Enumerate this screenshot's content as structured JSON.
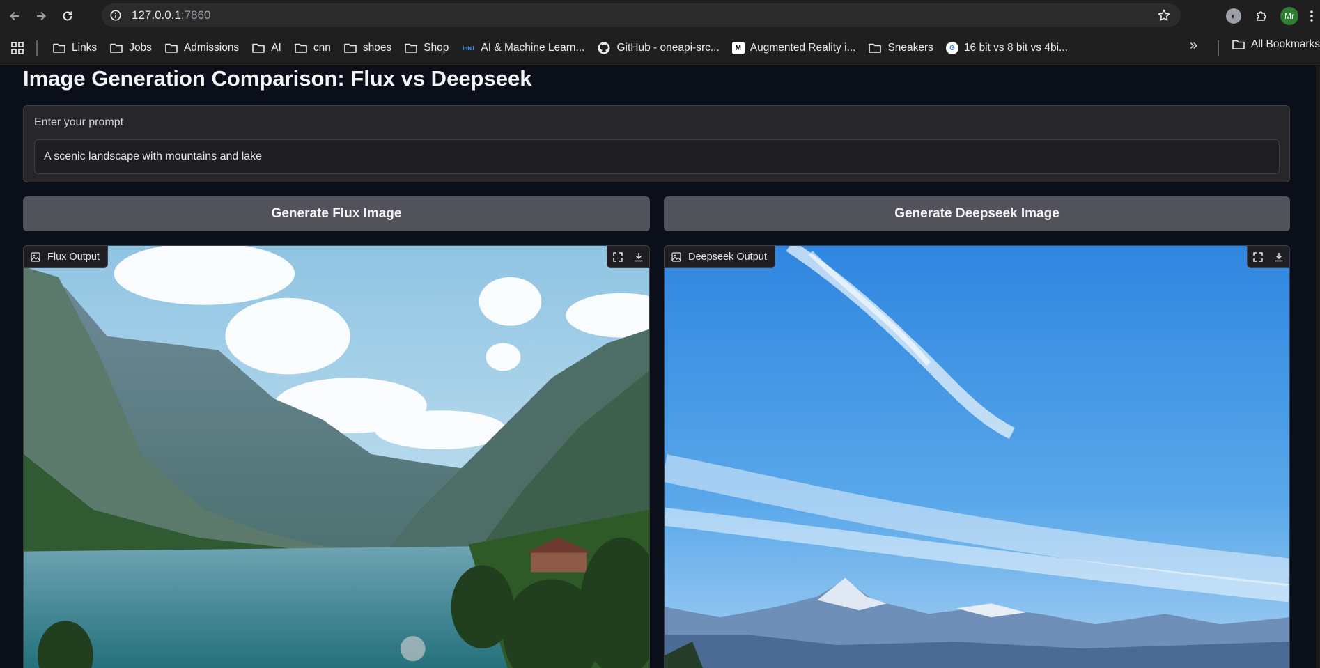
{
  "browser": {
    "url_host": "127.0.0.1",
    "url_port": ":7860",
    "profile_initials": "Mr"
  },
  "bookmarks": [
    {
      "label": "Links",
      "icon": "folder-icon"
    },
    {
      "label": "Jobs",
      "icon": "folder-icon"
    },
    {
      "label": "Admissions",
      "icon": "folder-icon"
    },
    {
      "label": "AI",
      "icon": "folder-icon"
    },
    {
      "label": "cnn",
      "icon": "folder-icon"
    },
    {
      "label": "shoes",
      "icon": "folder-icon"
    },
    {
      "label": "Shop",
      "icon": "folder-icon"
    },
    {
      "label": "AI & Machine Learn...",
      "icon": "intel-favicon"
    },
    {
      "label": "GitHub - oneapi-src...",
      "icon": "github-favicon"
    },
    {
      "label": "Augmented Reality i...",
      "icon": "medium-favicon"
    },
    {
      "label": "Sneakers",
      "icon": "folder-icon"
    },
    {
      "label": "16 bit vs 8 bit vs 4bi...",
      "icon": "google-favicon"
    }
  ],
  "bookmarks_all": "All Bookmarks",
  "favicon_text": {
    "intel": "intel",
    "medium": "M",
    "google": "G"
  },
  "page": {
    "title": "Image Generation Comparison: Flux vs Deepseek",
    "prompt_label": "Enter your prompt",
    "prompt_value": "A scenic landscape with mountains and lake",
    "flux_button": "Generate Flux Image",
    "deepseek_button": "Generate Deepseek Image",
    "flux_output_label": "Flux Output",
    "deepseek_output_label": "Deepseek Output"
  },
  "colors": {
    "page_bg": "#0b0f19",
    "panel_bg": "#27272a",
    "button_bg": "#52525b",
    "chrome_bg": "#1f1f1f"
  }
}
